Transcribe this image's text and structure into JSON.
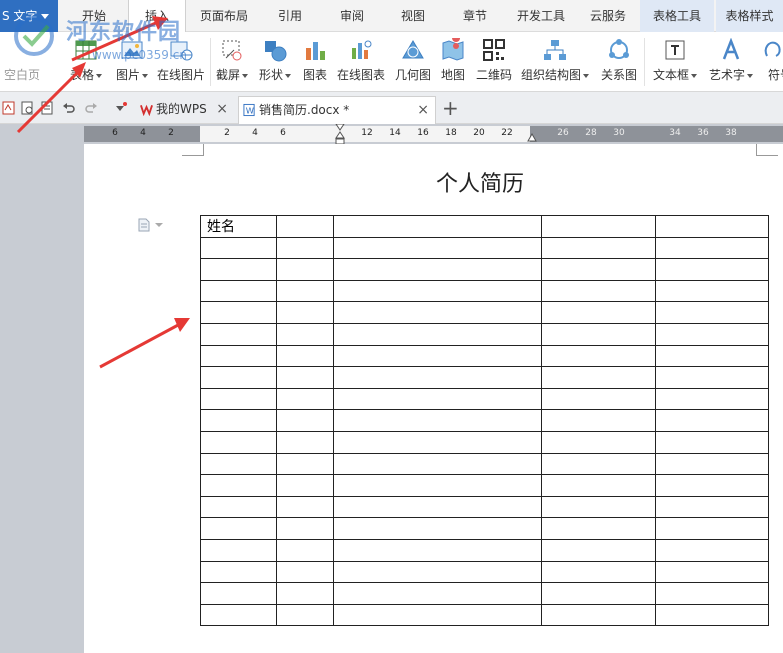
{
  "menubar": {
    "app_name": "S 文字",
    "tabs": [
      {
        "label": "开始"
      },
      {
        "label": "插入"
      },
      {
        "label": "页面布局"
      },
      {
        "label": "引用"
      },
      {
        "label": "审阅"
      },
      {
        "label": "视图"
      },
      {
        "label": "章节"
      },
      {
        "label": "开发工具"
      },
      {
        "label": "云服务"
      },
      {
        "label": "表格工具"
      },
      {
        "label": "表格样式"
      }
    ]
  },
  "ribbon": {
    "blank_page": "空白页",
    "items": [
      {
        "label": "表格",
        "icon": "table-icon"
      },
      {
        "label": "图片",
        "icon": "picture-icon"
      },
      {
        "label": "在线图片",
        "icon": "online-picture-icon"
      },
      {
        "label": "截屏",
        "icon": "screenshot-icon"
      },
      {
        "label": "形状",
        "icon": "shapes-icon"
      },
      {
        "label": "图表",
        "icon": "chart-icon"
      },
      {
        "label": "在线图表",
        "icon": "online-chart-icon"
      },
      {
        "label": "几何图",
        "icon": "geometry-icon"
      },
      {
        "label": "地图",
        "icon": "map-icon"
      },
      {
        "label": "二维码",
        "icon": "qrcode-icon"
      },
      {
        "label": "组织结构图",
        "icon": "org-chart-icon"
      },
      {
        "label": "关系图",
        "icon": "relation-chart-icon"
      },
      {
        "label": "文本框",
        "icon": "textbox-icon"
      },
      {
        "label": "艺术字",
        "icon": "wordart-icon"
      },
      {
        "label": "符号",
        "icon": "symbol-icon"
      }
    ]
  },
  "tabstrip": {
    "tabs": [
      {
        "label": "我的WPS",
        "close": "×"
      },
      {
        "label": "销售简历.docx *",
        "close": "×"
      }
    ],
    "new_tab": "+"
  },
  "ruler": {
    "left_numbers": [
      "6",
      "4",
      "2"
    ],
    "white_numbers": [
      "2",
      "4",
      "6"
    ],
    "right_numbers": [
      "12",
      "14",
      "16",
      "18",
      "20",
      "22",
      "26",
      "28",
      "30",
      "34",
      "36",
      "38"
    ]
  },
  "document": {
    "title": "个人简历",
    "table": {
      "rows": 19,
      "cols": 5,
      "cells": [
        [
          "姓名",
          "",
          "",
          "",
          ""
        ]
      ]
    }
  },
  "watermark": {
    "site_name": "河东软件园",
    "url": "www.pc0359.cn"
  },
  "colors": {
    "accent": "#2f6fc1",
    "arrow": "#e53935",
    "context_tab": "#dfe8f5"
  }
}
